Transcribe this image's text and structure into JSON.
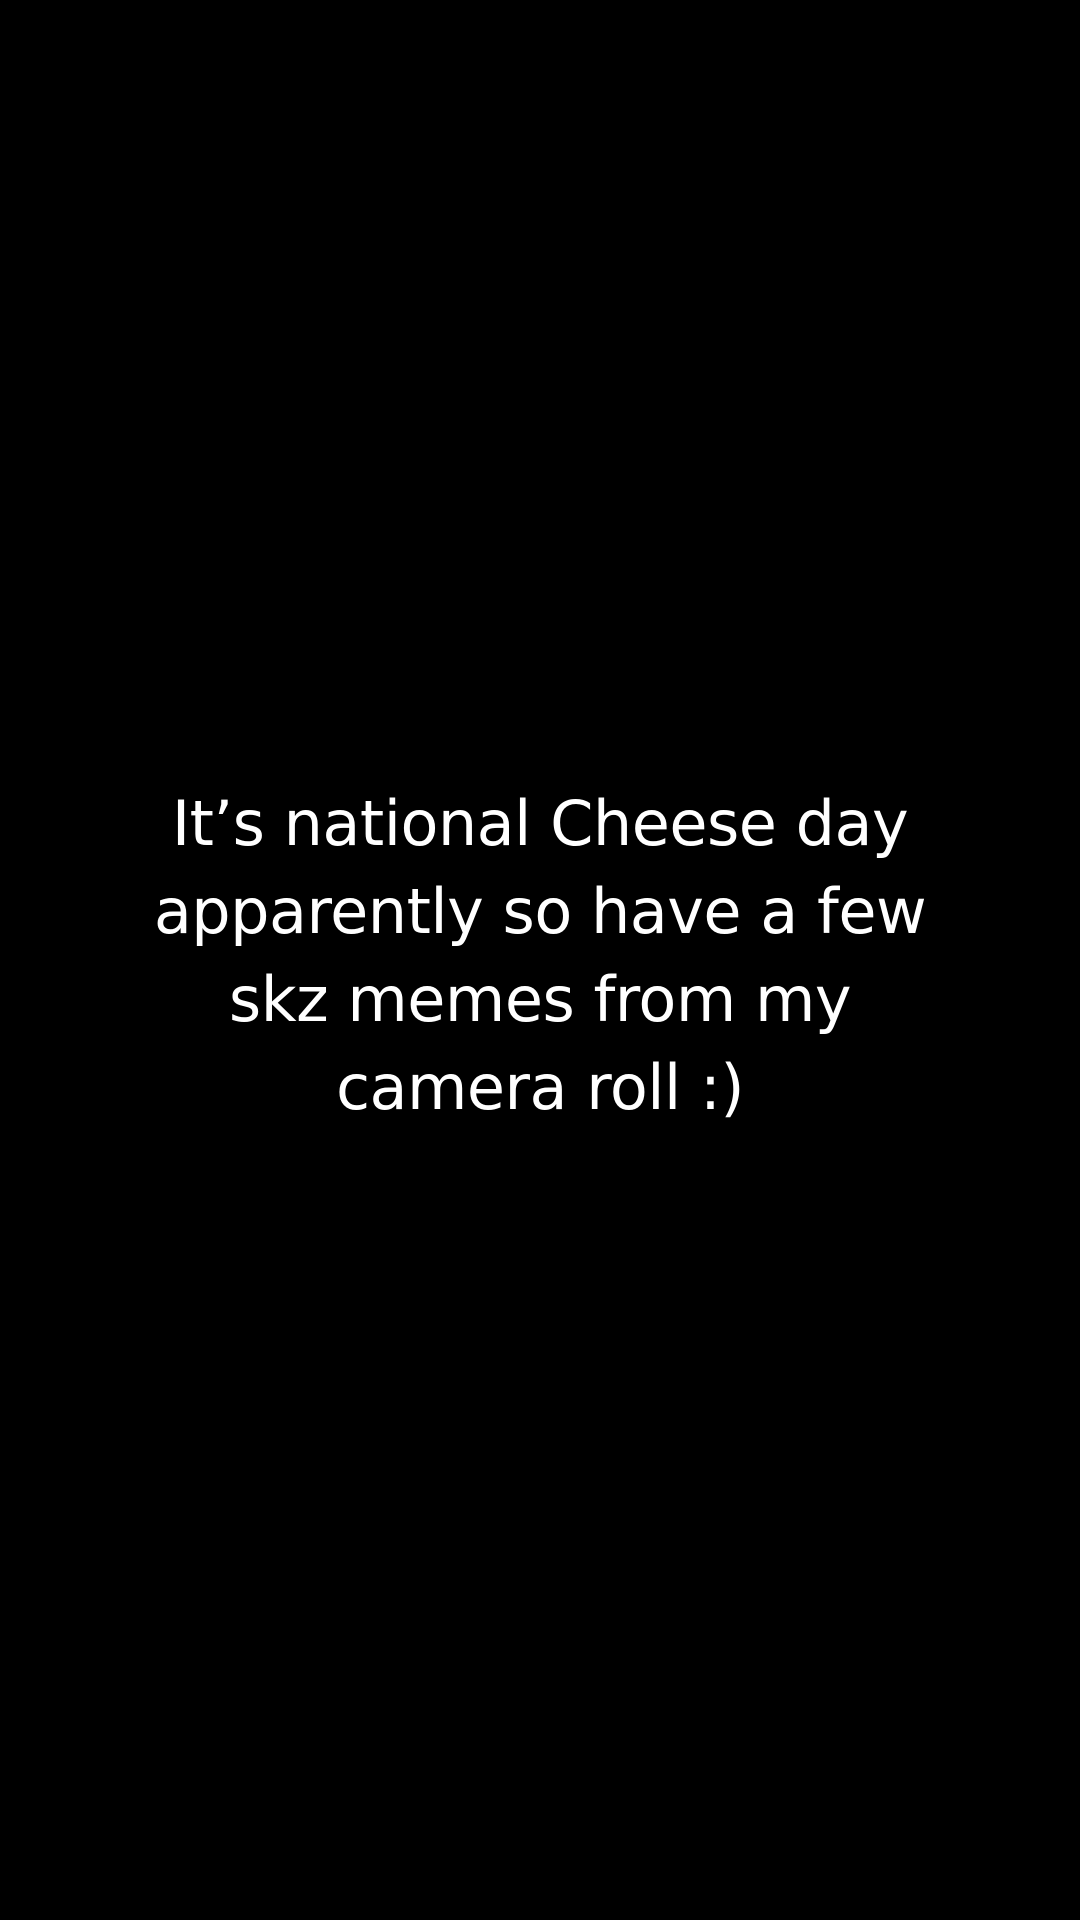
{
  "screen": {
    "background_color": "#000000",
    "text_color": "#ffffff"
  },
  "caption": {
    "lines": [
      "It’s national Cheese day",
      "apparently so have a few",
      "skz memes from my",
      "camera roll :)"
    ]
  }
}
